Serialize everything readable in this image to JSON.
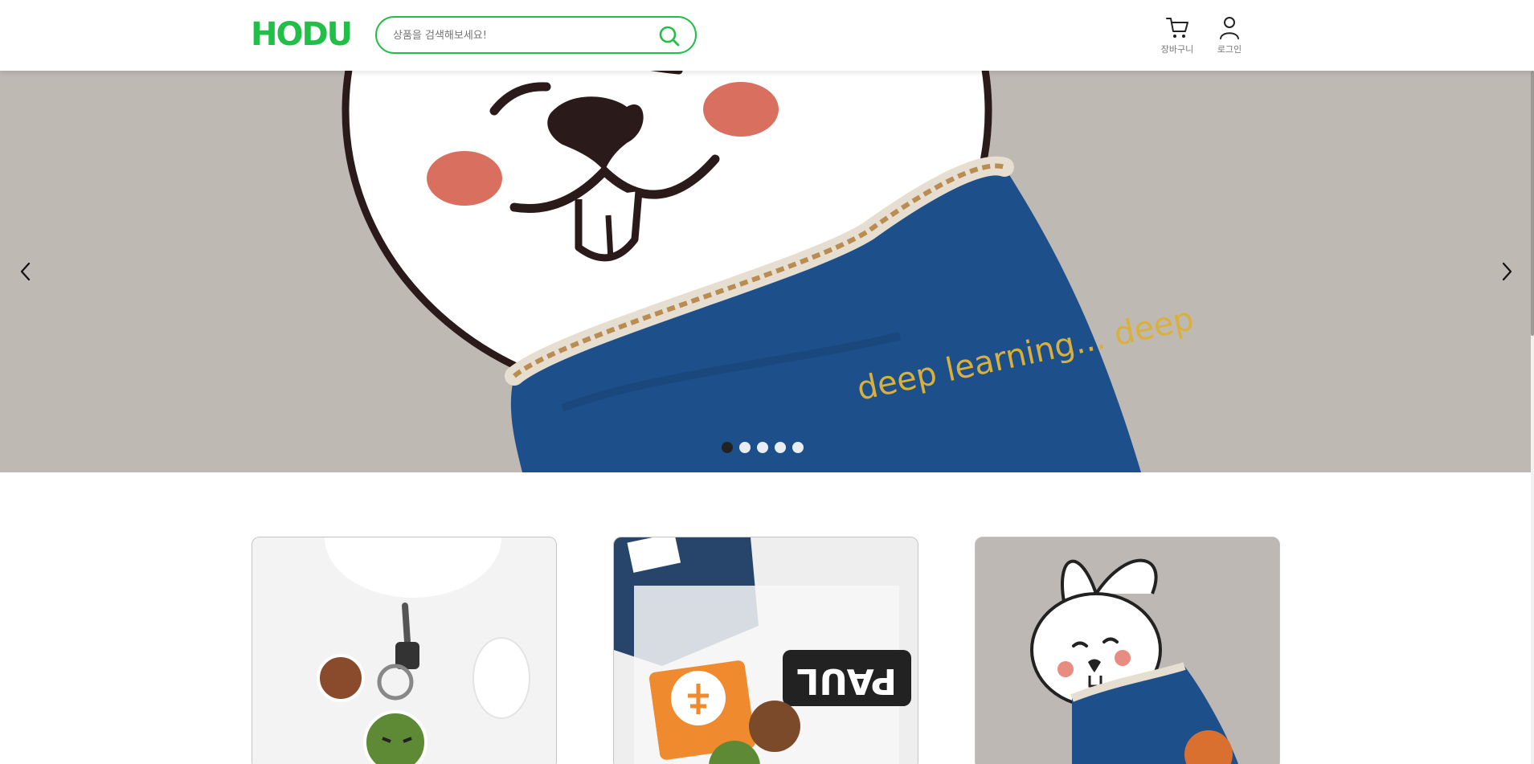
{
  "header": {
    "logo_text": "HODU",
    "search": {
      "placeholder": "상품을 검색해보세요!",
      "value": ""
    },
    "nav": {
      "cart_label": "장바구니",
      "login_label": "로그인"
    }
  },
  "carousel": {
    "slide_count": 5,
    "active_index": 0,
    "slide_caption": "deep learning... deep"
  },
  "products": [
    {
      "icon": "keyring-product-image"
    },
    {
      "icon": "sticker-pack-product-image"
    },
    {
      "icon": "rabbit-plush-product-image"
    }
  ],
  "colors": {
    "brand": "#21bf48",
    "hero_bg": "#bfb9b4",
    "blush": "#d9705f",
    "plush_blue": "#1d4f8a"
  }
}
